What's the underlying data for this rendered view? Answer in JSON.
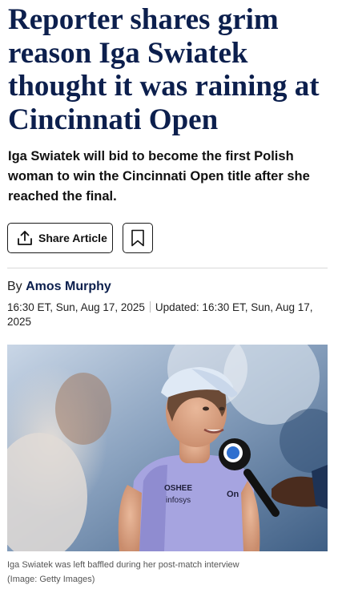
{
  "article": {
    "headline": "Reporter shares grim reason Iga Swiatek thought it was raining at Cincinnati Open",
    "standfirst": "Iga Swiatek will bid to become the first Polish woman to win the Cincinnati Open title after she reached the final.",
    "share_label": "Share Article",
    "byline_prefix": "By",
    "author": "Amos Murphy",
    "published": "16:30 ET, Sun, Aug 17, 2025",
    "updated": "Updated: 16:30 ET, Sun, Aug 17, 2025",
    "image": {
      "caption": "Iga Swiatek was left baffled during her post-match interview",
      "credit": "(Image: Getty Images)",
      "shirt_text_1": "OSHEE",
      "shirt_text_2": "infosys",
      "shirt_text_3": "On"
    }
  },
  "icons": {
    "share": "share-upload-icon",
    "bookmark": "bookmark-icon"
  },
  "colors": {
    "headline": "#0c1f4d",
    "author": "#0c1f4d"
  }
}
